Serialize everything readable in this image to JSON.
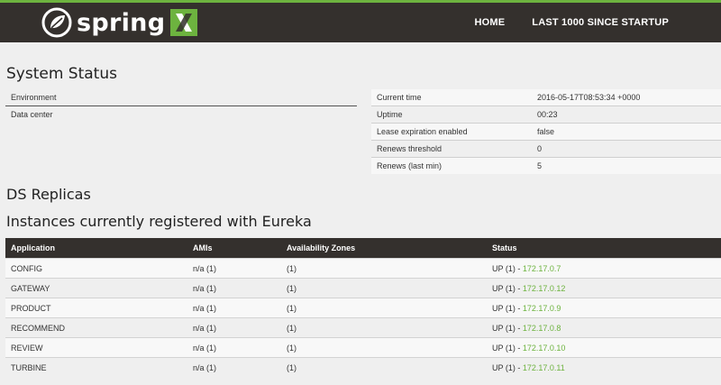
{
  "header": {
    "brand_text": "spring",
    "nav": [
      {
        "label": "HOME"
      },
      {
        "label": "LAST 1000 SINCE STARTUP"
      }
    ],
    "colors": {
      "bar": "#34302d",
      "accent": "#6db33f"
    }
  },
  "system_status": {
    "title": "System Status",
    "left": [
      {
        "key": "Environment",
        "value": ""
      },
      {
        "key": "Data center",
        "value": ""
      }
    ],
    "right": [
      {
        "key": "Current time",
        "value": "2016-05-17T08:53:34 +0000"
      },
      {
        "key": "Uptime",
        "value": "00:23"
      },
      {
        "key": "Lease expiration enabled",
        "value": "false"
      },
      {
        "key": "Renews threshold",
        "value": "0"
      },
      {
        "key": "Renews (last min)",
        "value": "5"
      }
    ]
  },
  "replicas": {
    "title": "DS Replicas"
  },
  "instances": {
    "title": "Instances currently registered with Eureka",
    "columns": [
      "Application",
      "AMIs",
      "Availability Zones",
      "Status"
    ],
    "rows": [
      {
        "app": "CONFIG",
        "amis": "n/a (1)",
        "zones": "(1)",
        "status": "UP (1) - ",
        "ip": "172.17.0.7"
      },
      {
        "app": "GATEWAY",
        "amis": "n/a (1)",
        "zones": "(1)",
        "status": "UP (1) - ",
        "ip": "172.17.0.12"
      },
      {
        "app": "PRODUCT",
        "amis": "n/a (1)",
        "zones": "(1)",
        "status": "UP (1) - ",
        "ip": "172.17.0.9"
      },
      {
        "app": "RECOMMEND",
        "amis": "n/a (1)",
        "zones": "(1)",
        "status": "UP (1) - ",
        "ip": "172.17.0.8"
      },
      {
        "app": "REVIEW",
        "amis": "n/a (1)",
        "zones": "(1)",
        "status": "UP (1) - ",
        "ip": "172.17.0.10"
      },
      {
        "app": "TURBINE",
        "amis": "n/a (1)",
        "zones": "(1)",
        "status": "UP (1) - ",
        "ip": "172.17.0.11"
      }
    ]
  }
}
